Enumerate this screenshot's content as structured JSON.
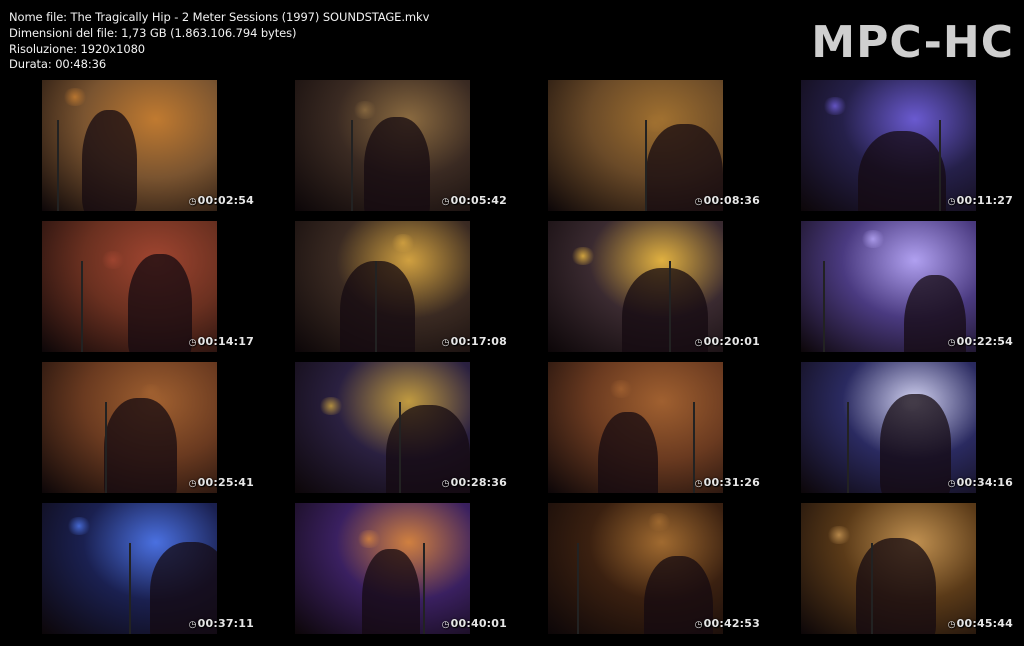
{
  "header": {
    "file_name": "Nome file: The Tragically Hip - 2 Meter Sessions (1997) SOUNDSTAGE.mkv",
    "file_size": "Dimensioni del file: 1,73 GB (1.863.106.794 bytes)",
    "resolution": "Risoluzione: 1920x1080",
    "duration": "Durata: 00:48:36",
    "logo": "MPC-HC"
  },
  "thumbnails": [
    {
      "time": "00:02:54",
      "bg": "#7a5430",
      "accent": "#c07a30"
    },
    {
      "time": "00:05:42",
      "bg": "#3a2a22",
      "accent": "#8a6a40"
    },
    {
      "time": "00:08:36",
      "bg": "#6a4a28",
      "accent": "#a07030"
    },
    {
      "time": "00:11:27",
      "bg": "#25204a",
      "accent": "#6a5ad0"
    },
    {
      "time": "00:14:17",
      "bg": "#6a3020",
      "accent": "#a04530"
    },
    {
      "time": "00:17:08",
      "bg": "#3a2a22",
      "accent": "#d0a040"
    },
    {
      "time": "00:20:01",
      "bg": "#3a2a30",
      "accent": "#e0b040"
    },
    {
      "time": "00:22:54",
      "bg": "#4a3a80",
      "accent": "#b0a0f0"
    },
    {
      "time": "00:25:41",
      "bg": "#6a3a20",
      "accent": "#a06030"
    },
    {
      "time": "00:28:36",
      "bg": "#2a2040",
      "accent": "#c09a40"
    },
    {
      "time": "00:31:26",
      "bg": "#6a3a20",
      "accent": "#a06030"
    },
    {
      "time": "00:34:16",
      "bg": "#2a2a60",
      "accent": "#d0d0f0"
    },
    {
      "time": "00:37:11",
      "bg": "#1a2050",
      "accent": "#4a70e0"
    },
    {
      "time": "00:40:01",
      "bg": "#3a2060",
      "accent": "#d08040"
    },
    {
      "time": "00:42:53",
      "bg": "#3a2010",
      "accent": "#a06a30"
    },
    {
      "time": "00:45:44",
      "bg": "#5a3a18",
      "accent": "#c09050"
    }
  ]
}
